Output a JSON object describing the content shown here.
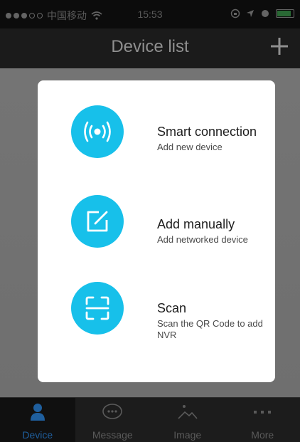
{
  "status_bar": {
    "carrier": "中国移动",
    "time": "15:53"
  },
  "header": {
    "title": "Device list",
    "add_icon": "plus-icon"
  },
  "modal": {
    "options": [
      {
        "title": "Smart connection",
        "subtitle": "Add new device",
        "icon": "wireless-signal-icon"
      },
      {
        "title": "Add manually",
        "subtitle": "Add networked device",
        "icon": "edit-square-icon"
      },
      {
        "title": "Scan",
        "subtitle": "Scan the QR Code to add NVR",
        "icon": "scan-frame-icon"
      }
    ]
  },
  "tabs": [
    {
      "label": "Device",
      "icon": "person-icon",
      "active": true
    },
    {
      "label": "Message",
      "icon": "chat-bubble-icon",
      "active": false
    },
    {
      "label": "Image",
      "icon": "image-icon",
      "active": false
    },
    {
      "label": "More",
      "icon": "more-dots-icon",
      "active": false
    }
  ],
  "colors": {
    "accent": "#17c0ea",
    "tab_active": "#1f5f9e",
    "modal_bg": "#ffffff"
  }
}
